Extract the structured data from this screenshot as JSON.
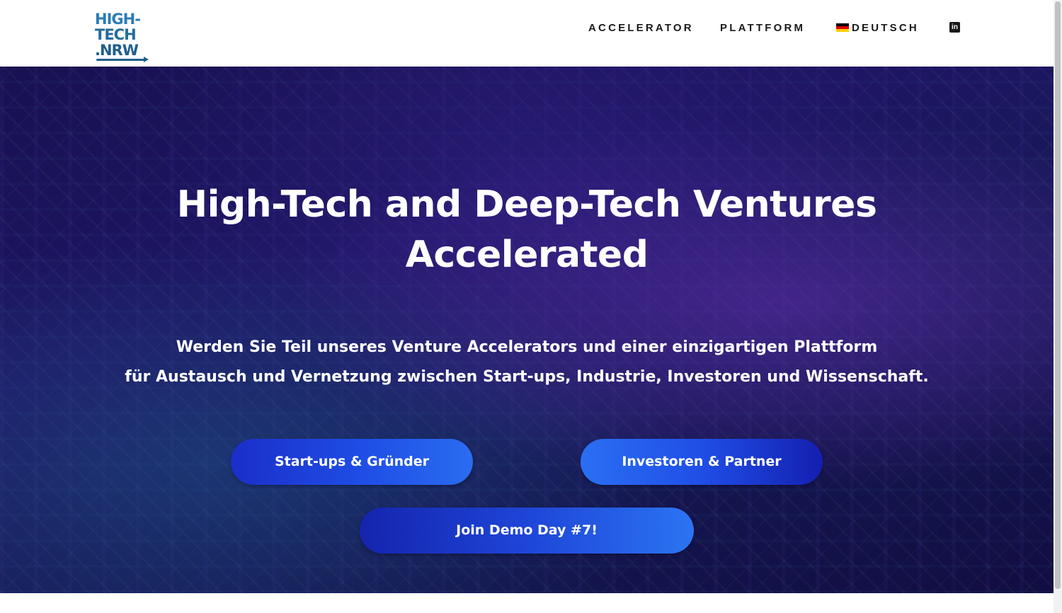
{
  "header": {
    "logo": {
      "line1": "HIGH-",
      "line2": "TECH",
      "line3": ".NRW"
    },
    "nav": [
      {
        "label": "ACCELERATOR"
      },
      {
        "label": "PLATTFORM"
      },
      {
        "label": "DEUTSCH",
        "icon": "german-flag-icon"
      }
    ],
    "social": {
      "icon": "linkedin-icon",
      "glyph": "in"
    }
  },
  "hero": {
    "title_line1": "High-Tech and Deep-Tech Ventures",
    "title_line2": "Accelerated",
    "subtitle_line1": "Werden Sie Teil unseres Venture Accelerators und einer einzigartigen Plattform",
    "subtitle_line2": "für Austausch und Vernetzung zwischen Start-ups, Industrie, Investoren und Wissenschaft.",
    "buttons": {
      "startups": "Start-ups & Gründer",
      "investors": "Investoren & Partner",
      "demo_day": "Join Demo Day #7!"
    }
  },
  "colors": {
    "logo": "#1f5f8c",
    "button_primary": "#1f4ee6",
    "hero_bg": "#1c1560"
  }
}
